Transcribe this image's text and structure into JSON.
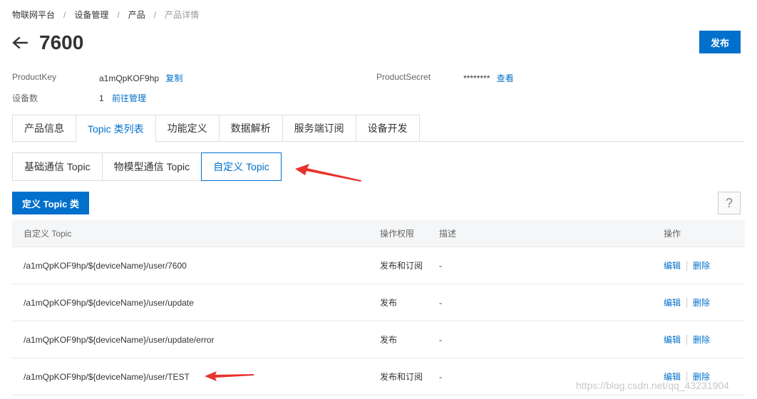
{
  "breadcrumb": {
    "items": [
      "物联网平台",
      "设备管理",
      "产品",
      "产品详情"
    ],
    "separator": "/"
  },
  "header": {
    "title": "7600",
    "publish_label": "发布"
  },
  "meta": {
    "product_key_label": "ProductKey",
    "product_key_value": "a1mQpKOF9hp",
    "copy_label": "复制",
    "product_secret_label": "ProductSecret",
    "product_secret_value": "********",
    "view_label": "查看",
    "device_count_label": "设备数",
    "device_count_value": "1",
    "goto_manage_label": "前往管理"
  },
  "main_tabs": [
    {
      "label": "产品信息",
      "active": false
    },
    {
      "label": "Topic 类列表",
      "active": true
    },
    {
      "label": "功能定义",
      "active": false
    },
    {
      "label": "数据解析",
      "active": false
    },
    {
      "label": "服务端订阅",
      "active": false
    },
    {
      "label": "设备开发",
      "active": false
    }
  ],
  "sub_tabs": [
    {
      "label": "基础通信 Topic",
      "active": false
    },
    {
      "label": "物模型通信 Topic",
      "active": false
    },
    {
      "label": "自定义 Topic",
      "active": true
    }
  ],
  "toolbar": {
    "define_topic_label": "定义 Topic 类",
    "help_label": "?"
  },
  "table": {
    "headers": {
      "topic": "自定义 Topic",
      "permission": "操作权限",
      "description": "描述",
      "operation": "操作"
    },
    "edit_label": "编辑",
    "delete_label": "删除",
    "rows": [
      {
        "topic": "/a1mQpKOF9hp/${deviceName}/user/7600",
        "permission": "发布和订阅",
        "description": "-"
      },
      {
        "topic": "/a1mQpKOF9hp/${deviceName}/user/update",
        "permission": "发布",
        "description": "-"
      },
      {
        "topic": "/a1mQpKOF9hp/${deviceName}/user/update/error",
        "permission": "发布",
        "description": "-"
      },
      {
        "topic": "/a1mQpKOF9hp/${deviceName}/user/TEST",
        "permission": "发布和订阅",
        "description": "-"
      }
    ]
  },
  "watermark": "https://blog.csdn.net/qq_43231904",
  "colors": {
    "primary": "#0070cc",
    "annotation_arrow": "#e8322e"
  }
}
